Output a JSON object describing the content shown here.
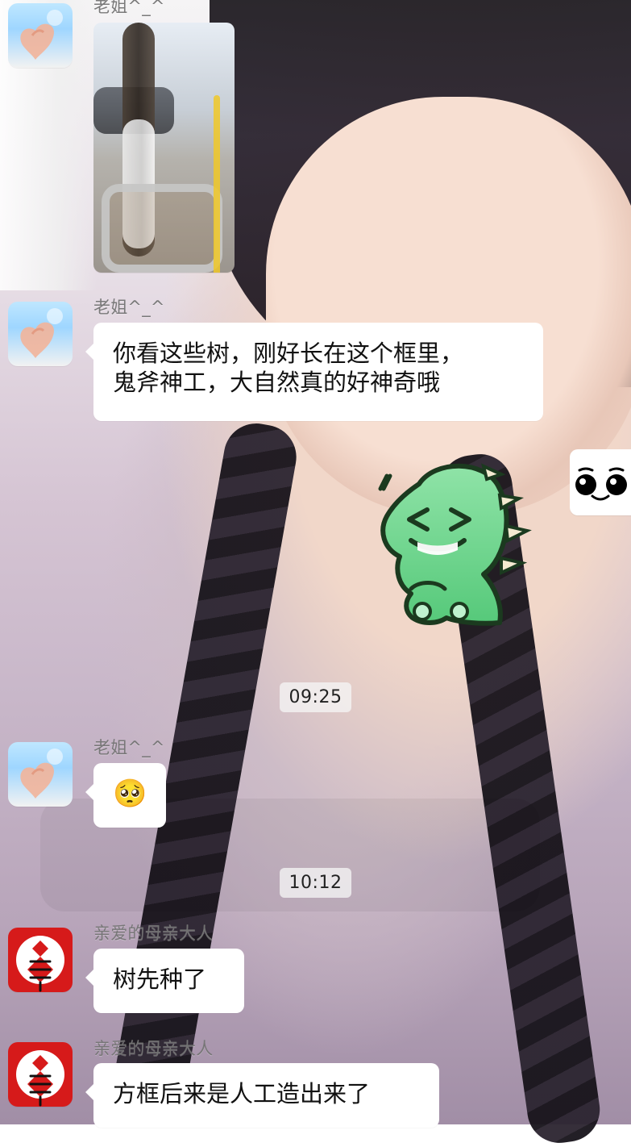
{
  "messages": [
    {
      "sender": "老姐^_^",
      "type": "image"
    },
    {
      "sender": "老姐^_^",
      "type": "text",
      "text_lines": [
        "你看这些树，刚好长在这个框里，",
        "鬼斧神工，大自然真的好神奇哦"
      ]
    },
    {
      "type": "sticker"
    },
    {
      "type": "timestamp",
      "text": "09:25"
    },
    {
      "sender": "老姐^_^",
      "type": "emoji",
      "emoji": "🥺"
    },
    {
      "type": "timestamp",
      "text": "10:12"
    },
    {
      "sender": "亲爱的母亲大人",
      "type": "text",
      "text": "树先种了"
    },
    {
      "sender": "亲爱的母亲大人",
      "type": "text",
      "text": "方框后来是人工造出来了"
    }
  ],
  "colors": {
    "bubble_bg": "#ffffff",
    "timestamp_bg": "#f5f5f5",
    "sender_text": "#737373"
  },
  "icons": {
    "sister_avatar": "heart-hands-avatar-icon",
    "mother_avatar": "chinese-knot-avatar-icon",
    "sticker": "green-dinosaur-sticker-icon"
  }
}
